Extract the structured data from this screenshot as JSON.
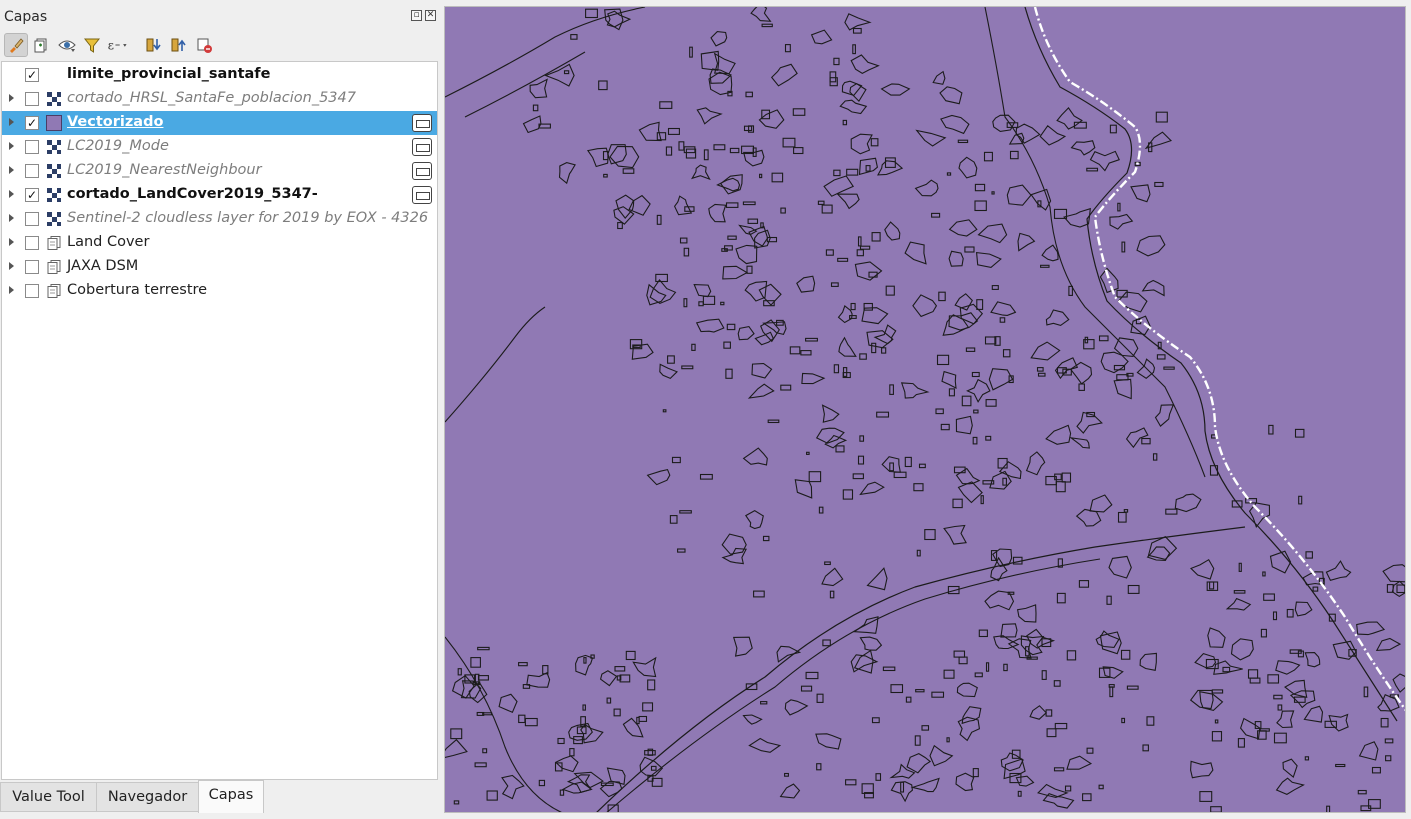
{
  "panel": {
    "title": "Capas"
  },
  "toolbar": {
    "buttons": [
      {
        "name": "style-manager-icon"
      },
      {
        "name": "add-group-icon"
      },
      {
        "name": "visibility-icon"
      },
      {
        "name": "filter-legend-icon"
      },
      {
        "name": "filter-expression-icon"
      },
      {
        "name": "expand-all-icon"
      },
      {
        "name": "collapse-all-icon"
      },
      {
        "name": "remove-layer-icon"
      }
    ]
  },
  "layers": [
    {
      "name": "limite_provincial_santafe",
      "checked": "✓",
      "style": "bold",
      "icon": "polygon-outline",
      "expandable": false,
      "selected": false,
      "side_indicator": false
    },
    {
      "name": "cortado_HRSL_SantaFe_poblacion_5347",
      "checked": "",
      "style": "italic",
      "icon": "raster",
      "expandable": true,
      "selected": false,
      "side_indicator": false
    },
    {
      "name": "Vectorizado",
      "checked": "✓",
      "style": "bold",
      "icon": "polygon-fill",
      "expandable": true,
      "selected": true,
      "side_indicator": true
    },
    {
      "name": "LC2019_Mode",
      "checked": "",
      "style": "italic",
      "icon": "raster",
      "expandable": true,
      "selected": false,
      "side_indicator": true
    },
    {
      "name": "LC2019_NearestNeighbour",
      "checked": "",
      "style": "italic",
      "icon": "raster",
      "expandable": true,
      "selected": false,
      "side_indicator": true
    },
    {
      "name": "cortado_LandCover2019_5347-",
      "checked": "✓",
      "style": "bold",
      "icon": "raster",
      "expandable": true,
      "selected": false,
      "side_indicator": true
    },
    {
      "name": "Sentinel-2 cloudless layer for 2019 by EOX - 4326",
      "checked": "",
      "style": "italic",
      "icon": "raster",
      "expandable": true,
      "selected": false,
      "side_indicator": false
    },
    {
      "name": "Land Cover",
      "checked": "",
      "style": "normal",
      "icon": "group",
      "expandable": true,
      "selected": false,
      "side_indicator": false
    },
    {
      "name": "JAXA DSM",
      "checked": "",
      "style": "normal",
      "icon": "group",
      "expandable": true,
      "selected": false,
      "side_indicator": false
    },
    {
      "name": "Cobertura terrestre",
      "checked": "",
      "style": "normal",
      "icon": "group",
      "expandable": true,
      "selected": false,
      "side_indicator": false
    }
  ],
  "tabs": [
    {
      "label": "Value Tool",
      "active": false
    },
    {
      "label": "Navegador",
      "active": false
    },
    {
      "label": "Capas",
      "active": true
    }
  ],
  "colors": {
    "map_fill": "#9079b4",
    "outline": "#1c1c1c",
    "selection": "#4aa9e3",
    "boundary_dash": "#ffffff"
  }
}
